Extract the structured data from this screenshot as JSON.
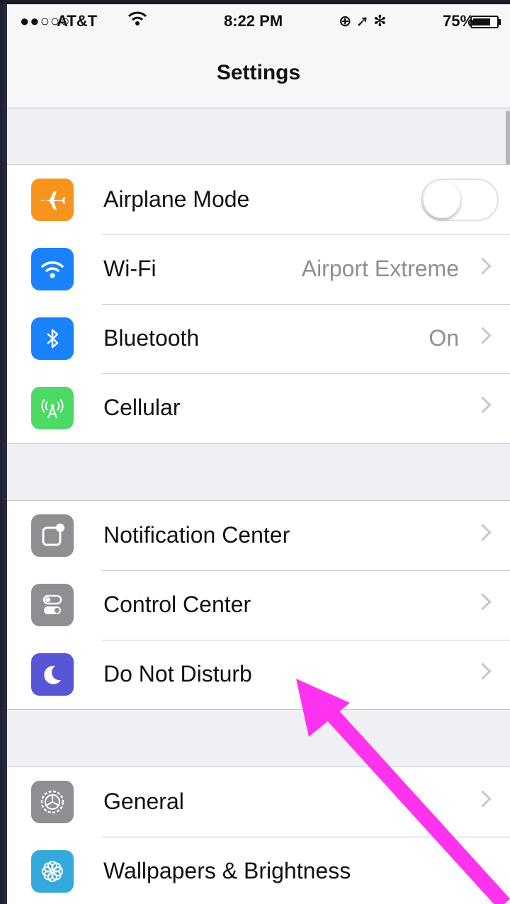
{
  "status_bar": {
    "signal_dots": "●●○○○",
    "carrier": "AT&T",
    "time": "8:22 PM",
    "icons": "⊕ ➚ ✻",
    "battery": "75%",
    "battery_level": 0.75
  },
  "nav": {
    "title": "Settings"
  },
  "groups": [
    {
      "rows": [
        {
          "label": "Airplane Mode",
          "icon": "airplane-icon",
          "color": "#f7941d",
          "control": "toggle",
          "toggle_on": false
        },
        {
          "label": "Wi-Fi",
          "detail": "Airport Extreme",
          "icon": "wifi-icon",
          "color": "#1a82fb"
        },
        {
          "label": "Bluetooth",
          "detail": "On",
          "icon": "bluetooth-icon",
          "color": "#1a82fb"
        },
        {
          "label": "Cellular",
          "icon": "cellular-icon",
          "color": "#4cd964"
        }
      ]
    },
    {
      "rows": [
        {
          "label": "Notification Center",
          "icon": "notification-center-icon",
          "color": "#8e8e93"
        },
        {
          "label": "Control Center",
          "icon": "control-center-icon",
          "color": "#8e8e93"
        },
        {
          "label": "Do Not Disturb",
          "icon": "moon-icon",
          "color": "#5856d6"
        }
      ]
    },
    {
      "rows": [
        {
          "label": "General",
          "icon": "gear-icon",
          "color": "#8e8e93"
        },
        {
          "label": "Wallpapers & Brightness",
          "icon": "flower-icon",
          "color": "#34aadc"
        }
      ]
    }
  ],
  "annotation": {
    "arrow_color": "#ff33ee"
  }
}
